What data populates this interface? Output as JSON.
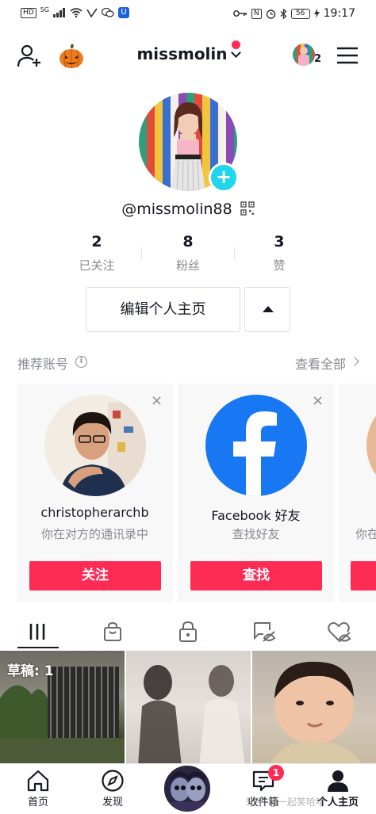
{
  "status_bar": {
    "left_icons": [
      "hd-icon",
      "5g-signal-icon",
      "wifi-icon",
      "check-icon",
      "wechat-icon",
      "u-app-icon"
    ],
    "net_label": "HD",
    "net_type": "5G",
    "u_label": "U",
    "battery": "56",
    "time": "19:17"
  },
  "header": {
    "username": "missmolin",
    "has_notification_dot": true,
    "accounts_count": "2",
    "colors": {
      "accent_red": "#fe2c55",
      "accent_cyan": "#20d5ec"
    }
  },
  "profile": {
    "handle": "@missmolin88",
    "add_icon": "+",
    "stats": [
      {
        "value": "2",
        "label": "已关注"
      },
      {
        "value": "8",
        "label": "粉丝"
      },
      {
        "value": "3",
        "label": "赞"
      }
    ],
    "edit_label": "编辑个人主页"
  },
  "recommended": {
    "title": "推荐账号",
    "info_icon": "i",
    "see_all": "查看全部",
    "close_icon": "×",
    "cards": [
      {
        "name": "christopherarchb",
        "subtitle": "你在对方的通讯录中",
        "button": "关注"
      },
      {
        "name": "Facebook 好友",
        "subtitle": "查找好友",
        "button": "查找"
      },
      {
        "name": "",
        "subtitle": "你在",
        "button": ""
      }
    ]
  },
  "content_tabs": [
    "videos-grid-icon",
    "shop-bag-icon",
    "private-lock-icon",
    "tagged-icon",
    "liked-icon"
  ],
  "grid": {
    "draft_label": "草稿: 1"
  },
  "bottom_nav": {
    "items": [
      {
        "label": "首页"
      },
      {
        "label": "发现"
      },
      {
        "label": ""
      },
      {
        "label": "收件箱",
        "badge": "1"
      },
      {
        "label": "个人主页"
      }
    ],
    "watermark": "知乎 @一起笑哈哈"
  }
}
